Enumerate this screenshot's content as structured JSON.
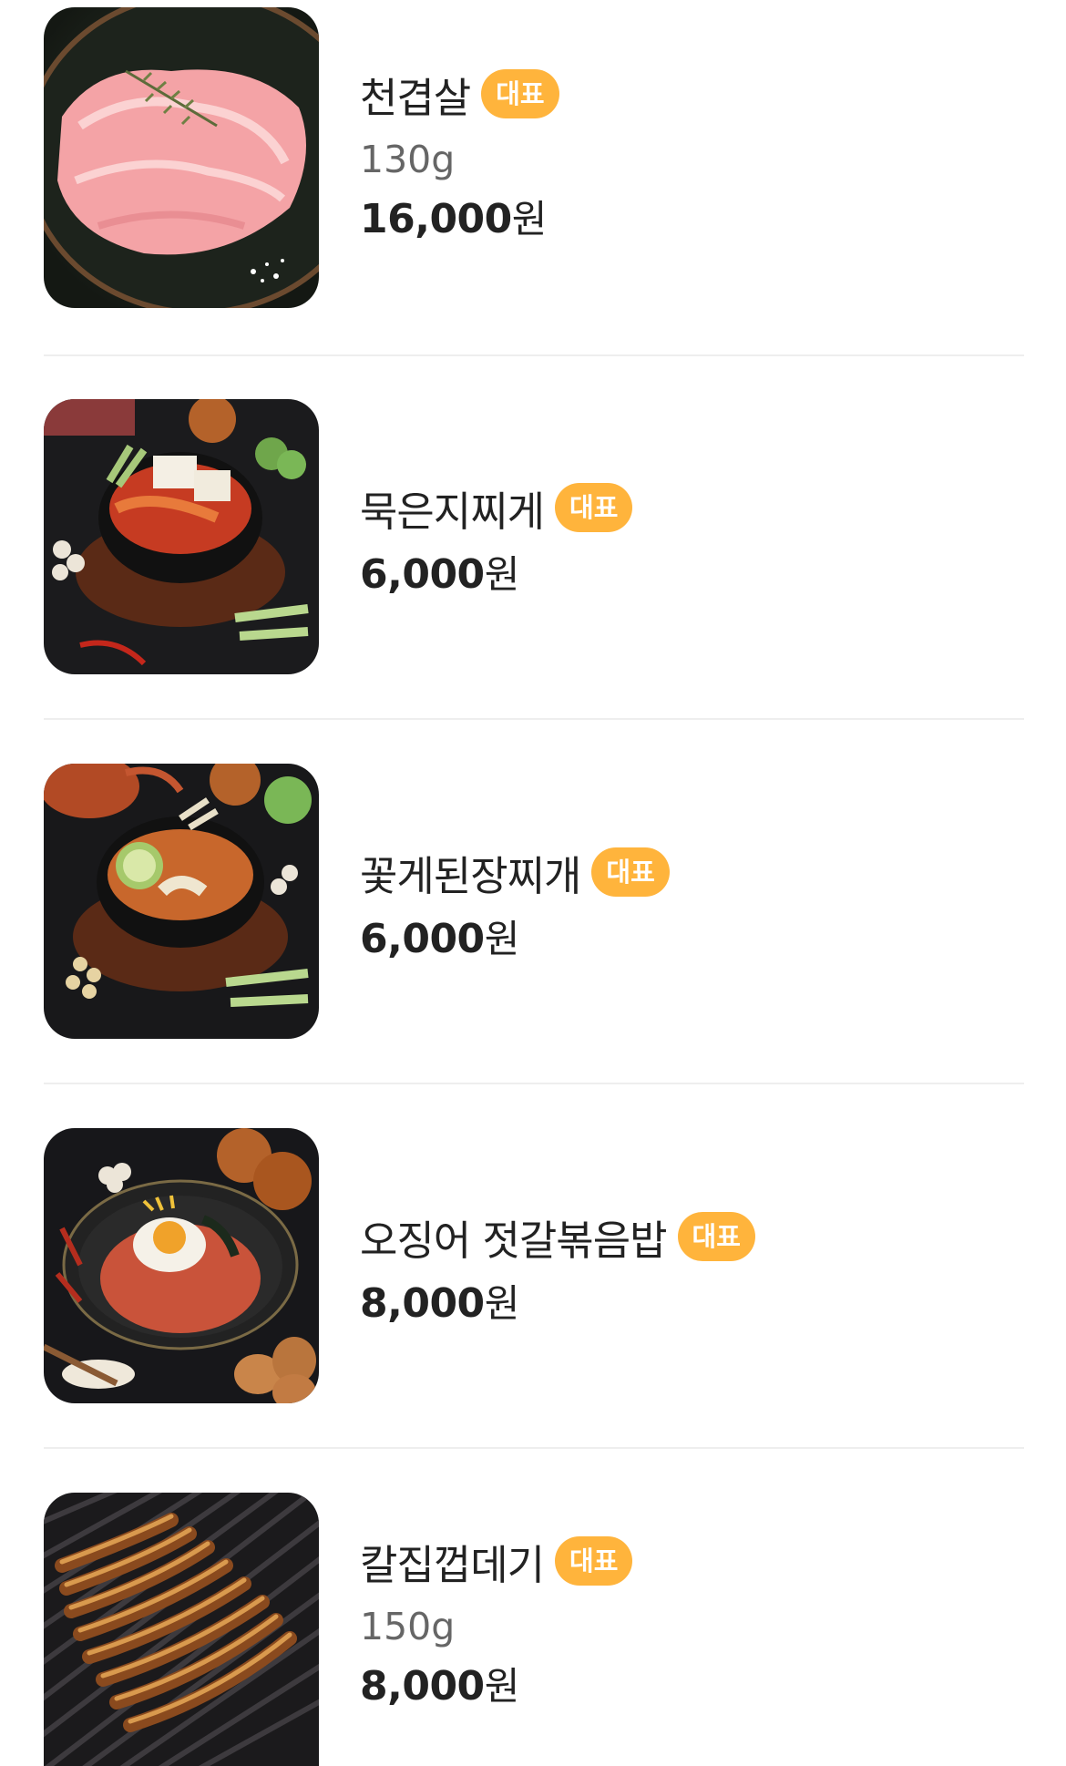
{
  "menu": {
    "items": [
      {
        "name": "천겹살",
        "badge": "대표",
        "weight": "130g",
        "price": "16,000",
        "currency": "원",
        "image_icon": "pork-belly-photo"
      },
      {
        "name": "묵은지찌게",
        "badge": "대표",
        "price": "6,000",
        "currency": "원",
        "image_icon": "kimchi-stew-photo"
      },
      {
        "name": "꽃게된장찌개",
        "badge": "대표",
        "price": "6,000",
        "currency": "원",
        "image_icon": "crab-soybean-stew-photo"
      },
      {
        "name": "오징어 젓갈볶음밥",
        "badge": "대표",
        "price": "8,000",
        "currency": "원",
        "image_icon": "squid-fried-rice-photo"
      },
      {
        "name": "칼집껍데기",
        "badge": "대표",
        "weight": "150g",
        "price": "8,000",
        "currency": "원",
        "image_icon": "grilled-pork-skin-photo"
      }
    ]
  },
  "colors": {
    "badge": "#ffb43c",
    "divider": "#eeeeee",
    "text_primary": "#222222",
    "text_secondary": "#666666"
  }
}
